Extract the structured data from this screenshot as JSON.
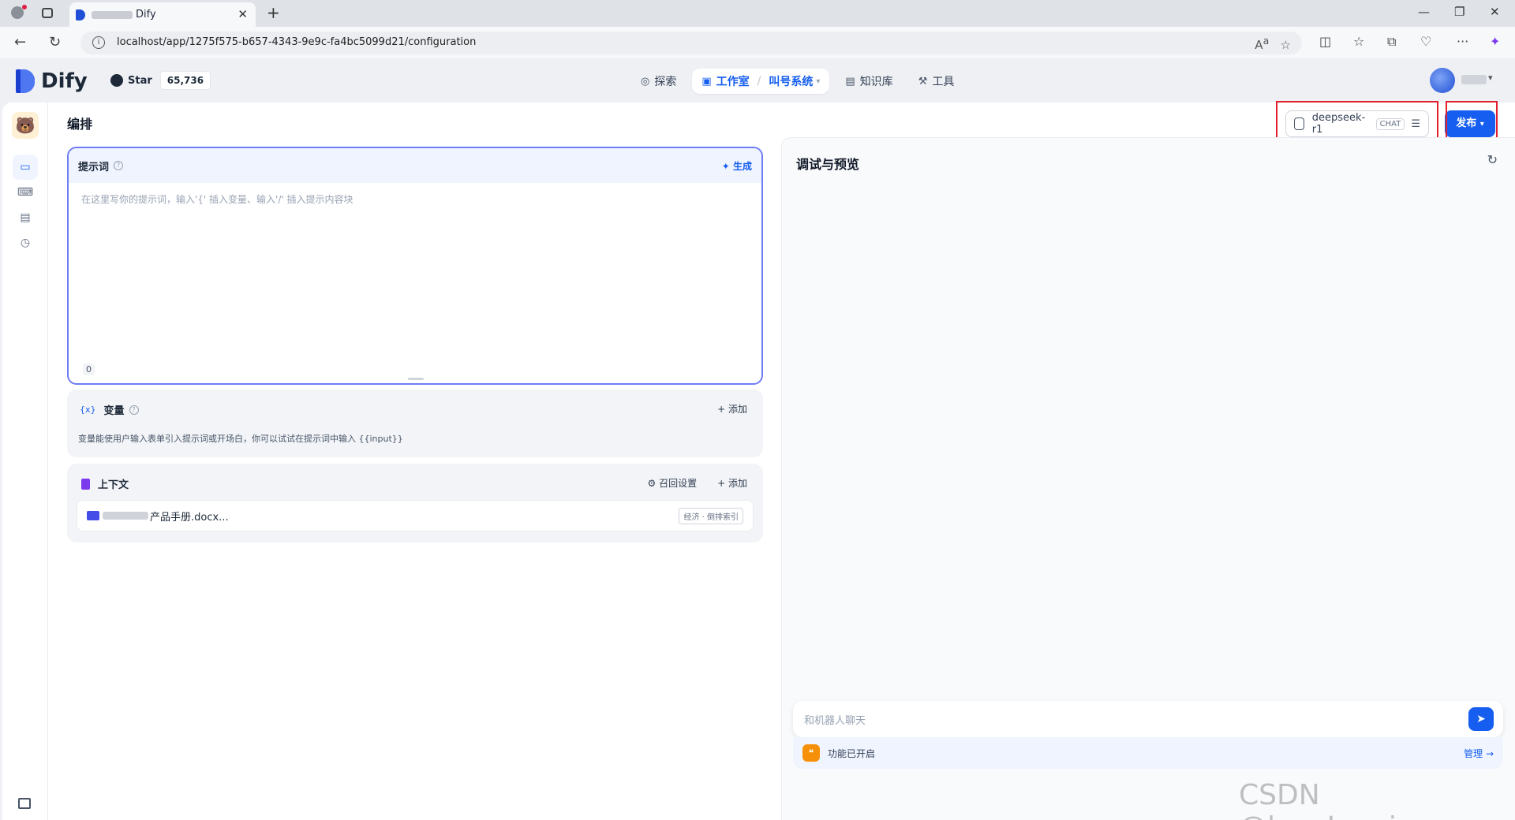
{
  "browser": {
    "tab_title": "Dify",
    "url": "localhost/app/1275f575-b657-4343-9e9c-fa4bc5099d21/configuration"
  },
  "header": {
    "logo": "Dify",
    "github_label": "Star",
    "github_count": "65,736",
    "nav": {
      "explore": "探索",
      "studio": "工作室",
      "app_name": "叫号系统",
      "knowledge": "知识库",
      "tools": "工具"
    }
  },
  "page": {
    "title": "编排",
    "model": {
      "name": "deepseek-r1",
      "tag": "CHAT"
    },
    "publish_label": "发布"
  },
  "prompt": {
    "title": "提示词",
    "generate_label": "生成",
    "placeholder": "在这里写你的提示词，输入'{' 插入变量、输入'/' 插入提示内容块",
    "char_count": "0"
  },
  "variables": {
    "title": "变量",
    "add_label": "添加",
    "description": "变量能使用户输入表单引入提示词或开场白，你可以试试在提示词中输入 {{input}}"
  },
  "context": {
    "title": "上下文",
    "recall_label": "召回设置",
    "add_label": "添加",
    "item_name": "产品手册.docx...",
    "item_badge": "经济 · 倒排索引"
  },
  "debug": {
    "title": "调试与预览",
    "chat_placeholder": "和机器人聊天",
    "features_label": "功能已开启",
    "manage_label": "管理"
  },
  "watermark": "CSDN @loveJenniee",
  "colors": {
    "primary": "#155eef",
    "highlight": "#e01e2d"
  }
}
